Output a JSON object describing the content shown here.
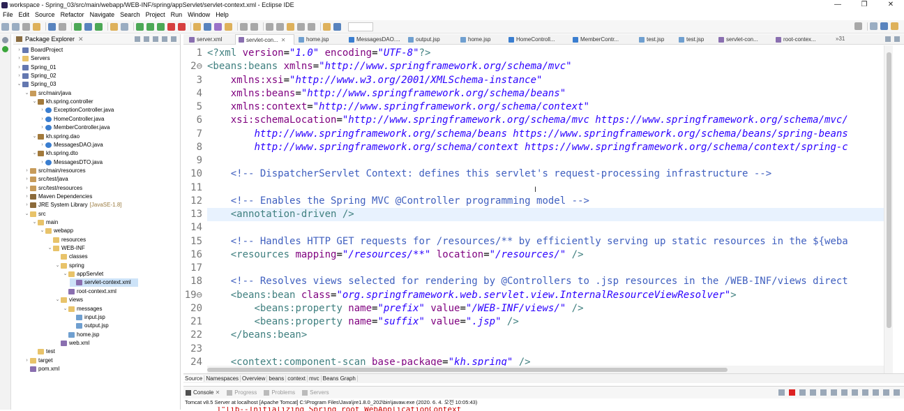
{
  "window": {
    "title": "workspace - Spring_03/src/main/webapp/WEB-INF/spring/appServlet/servlet-context.xml - Eclipse IDE",
    "controls": [
      "—",
      "❐",
      "✕"
    ]
  },
  "menu": [
    "File",
    "Edit",
    "Source",
    "Refactor",
    "Navigate",
    "Search",
    "Project",
    "Run",
    "Window",
    "Help"
  ],
  "package_explorer": {
    "title": "Package Explorer",
    "close": "✕",
    "tree": [
      {
        "label": "BoardProject",
        "icon": "proj",
        "twisty": "›",
        "depth": 0
      },
      {
        "label": "Servers",
        "icon": "fold",
        "twisty": "›",
        "depth": 0
      },
      {
        "label": "Spring_01",
        "icon": "proj",
        "twisty": "›",
        "depth": 0
      },
      {
        "label": "Spring_02",
        "icon": "proj",
        "twisty": "›",
        "depth": 0
      },
      {
        "label": "Spring_03",
        "icon": "proj",
        "twisty": "⌄",
        "depth": 0
      },
      {
        "label": "src/main/java",
        "icon": "pkgf",
        "twisty": "⌄",
        "depth": 1
      },
      {
        "label": "kh.spring.controller",
        "icon": "pkg",
        "twisty": "⌄",
        "depth": 2
      },
      {
        "label": "ExceptionController.java",
        "icon": "java",
        "twisty": "›",
        "depth": 3
      },
      {
        "label": "HomeController.java",
        "icon": "java",
        "twisty": "›",
        "depth": 3
      },
      {
        "label": "MemberController.java",
        "icon": "java",
        "twisty": "›",
        "depth": 3
      },
      {
        "label": "kh.spring.dao",
        "icon": "pkg",
        "twisty": "⌄",
        "depth": 2
      },
      {
        "label": "MessagesDAO.java",
        "icon": "java",
        "twisty": "›",
        "depth": 3
      },
      {
        "label": "kh.spring.dto",
        "icon": "pkg",
        "twisty": "⌄",
        "depth": 2
      },
      {
        "label": "MessagesDTO.java",
        "icon": "java",
        "twisty": "›",
        "depth": 3
      },
      {
        "label": "src/main/resources",
        "icon": "pkgf",
        "twisty": "›",
        "depth": 1
      },
      {
        "label": "src/test/java",
        "icon": "pkgf",
        "twisty": "›",
        "depth": 1
      },
      {
        "label": "src/test/resources",
        "icon": "pkgf",
        "twisty": "›",
        "depth": 1
      },
      {
        "label": "Maven Dependencies",
        "icon": "lib",
        "twisty": "›",
        "depth": 1
      },
      {
        "label": "JRE System Library",
        "icon": "lib",
        "twisty": "›",
        "depth": 1,
        "deco": "[JavaSE-1.8]"
      },
      {
        "label": "src",
        "icon": "fold",
        "twisty": "⌄",
        "depth": 1
      },
      {
        "label": "main",
        "icon": "fold",
        "twisty": "⌄",
        "depth": 2
      },
      {
        "label": "webapp",
        "icon": "fold",
        "twisty": "⌄",
        "depth": 3
      },
      {
        "label": "resources",
        "icon": "fold",
        "twisty": "",
        "depth": 4
      },
      {
        "label": "WEB-INF",
        "icon": "fold",
        "twisty": "⌄",
        "depth": 4
      },
      {
        "label": "classes",
        "icon": "fold",
        "twisty": "",
        "depth": 5
      },
      {
        "label": "spring",
        "icon": "fold",
        "twisty": "⌄",
        "depth": 5
      },
      {
        "label": "appServlet",
        "icon": "fold",
        "twisty": "⌄",
        "depth": 6
      },
      {
        "label": "servlet-context.xml",
        "icon": "xml",
        "twisty": "",
        "depth": 7,
        "selected": true
      },
      {
        "label": "root-context.xml",
        "icon": "xml",
        "twisty": "",
        "depth": 6
      },
      {
        "label": "views",
        "icon": "fold",
        "twisty": "⌄",
        "depth": 5
      },
      {
        "label": "messages",
        "icon": "fold",
        "twisty": "⌄",
        "depth": 6
      },
      {
        "label": "input.jsp",
        "icon": "jsp",
        "twisty": "",
        "depth": 7
      },
      {
        "label": "output.jsp",
        "icon": "jsp",
        "twisty": "",
        "depth": 7
      },
      {
        "label": "home.jsp",
        "icon": "jsp",
        "twisty": "",
        "depth": 6
      },
      {
        "label": "web.xml",
        "icon": "xml",
        "twisty": "",
        "depth": 5
      },
      {
        "label": "test",
        "icon": "fold",
        "twisty": "",
        "depth": 2
      },
      {
        "label": "target",
        "icon": "fold",
        "twisty": "›",
        "depth": 1
      },
      {
        "label": "pom.xml",
        "icon": "xml",
        "twisty": "",
        "depth": 1
      }
    ]
  },
  "editor": {
    "tabs": [
      {
        "label": "server.xml",
        "icon": "xml"
      },
      {
        "label": "servlet-con...",
        "icon": "xml",
        "active": true,
        "close": "✕"
      },
      {
        "label": "home.jsp",
        "icon": "jsp"
      },
      {
        "label": "MessagesDAO....",
        "icon": "java"
      },
      {
        "label": "output.jsp",
        "icon": "jsp"
      },
      {
        "label": "home.jsp",
        "icon": "jsp"
      },
      {
        "label": "HomeControll...",
        "icon": "java"
      },
      {
        "label": "MemberContr...",
        "icon": "java"
      },
      {
        "label": "test.jsp",
        "icon": "jsp"
      },
      {
        "label": "test.jsp",
        "icon": "jsp"
      },
      {
        "label": "servlet-con...",
        "icon": "xml"
      },
      {
        "label": "root-contex...",
        "icon": "xml"
      }
    ],
    "tabs_more": "»31",
    "lines": [
      {
        "n": "1",
        "t": [
          [
            "pi",
            "<?xml "
          ],
          [
            "at",
            "version"
          ],
          [
            "tx",
            "="
          ],
          [
            "st",
            "\"1.0\""
          ],
          [
            "tx",
            " "
          ],
          [
            "at",
            "encoding"
          ],
          [
            "tx",
            "="
          ],
          [
            "st",
            "\"UTF-8\""
          ],
          [
            "pi",
            "?>"
          ]
        ]
      },
      {
        "n": "2⊖",
        "t": [
          [
            "tag",
            "<beans:beans "
          ],
          [
            "at",
            "xmlns"
          ],
          [
            "tx",
            "="
          ],
          [
            "st",
            "\"http://www.springframework.org/schema/mvc\""
          ]
        ]
      },
      {
        "n": "3",
        "t": [
          [
            "tx",
            "    "
          ],
          [
            "at",
            "xmlns:xsi"
          ],
          [
            "tx",
            "="
          ],
          [
            "st",
            "\"http://www.w3.org/2001/XMLSchema-instance\""
          ]
        ]
      },
      {
        "n": "4",
        "t": [
          [
            "tx",
            "    "
          ],
          [
            "at",
            "xmlns:beans"
          ],
          [
            "tx",
            "="
          ],
          [
            "st",
            "\"http://www.springframework.org/schema/beans\""
          ]
        ]
      },
      {
        "n": "5",
        "t": [
          [
            "tx",
            "    "
          ],
          [
            "at",
            "xmlns:context"
          ],
          [
            "tx",
            "="
          ],
          [
            "st",
            "\"http://www.springframework.org/schema/context\""
          ]
        ]
      },
      {
        "n": "6",
        "t": [
          [
            "tx",
            "    "
          ],
          [
            "at",
            "xsi:schemaLocation"
          ],
          [
            "tx",
            "="
          ],
          [
            "st",
            "\"http://www.springframework.org/schema/mvc https://www.springframework.org/schema/mvc/"
          ]
        ]
      },
      {
        "n": "7",
        "t": [
          [
            "tx",
            "        "
          ],
          [
            "st",
            "http://www.springframework.org/schema/beans https://www.springframework.org/schema/beans/spring-beans"
          ]
        ]
      },
      {
        "n": "8",
        "t": [
          [
            "tx",
            "        "
          ],
          [
            "st",
            "http://www.springframework.org/schema/context https://www.springframework.org/schema/context/spring-c"
          ]
        ]
      },
      {
        "n": "9",
        "t": []
      },
      {
        "n": "10",
        "t": [
          [
            "tx",
            "    "
          ],
          [
            "cm",
            "<!-- DispatcherServlet Context: defines this servlet's request-processing infrastructure -->"
          ]
        ]
      },
      {
        "n": "11",
        "t": []
      },
      {
        "n": "12",
        "t": [
          [
            "tx",
            "    "
          ],
          [
            "cm",
            "<!-- Enables the Spring MVC @Controller programming model -->"
          ]
        ]
      },
      {
        "n": "13",
        "hl": true,
        "t": [
          [
            "tx",
            "    "
          ],
          [
            "tag",
            "<annotation-driven />"
          ]
        ]
      },
      {
        "n": "14",
        "t": []
      },
      {
        "n": "15",
        "t": [
          [
            "tx",
            "    "
          ],
          [
            "cm",
            "<!-- Handles HTTP GET requests for /resources/** by efficiently serving up static resources in the ${weba"
          ]
        ]
      },
      {
        "n": "16",
        "t": [
          [
            "tx",
            "    "
          ],
          [
            "tag",
            "<resources "
          ],
          [
            "at",
            "mapping"
          ],
          [
            "tx",
            "="
          ],
          [
            "st",
            "\"/resources/**\""
          ],
          [
            "tx",
            " "
          ],
          [
            "at",
            "location"
          ],
          [
            "tx",
            "="
          ],
          [
            "st",
            "\"/resources/\""
          ],
          [
            "tag",
            " />"
          ]
        ]
      },
      {
        "n": "17",
        "t": []
      },
      {
        "n": "18",
        "t": [
          [
            "tx",
            "    "
          ],
          [
            "cm",
            "<!-- Resolves views selected for rendering by @Controllers to .jsp resources in the /WEB-INF/views direct"
          ]
        ]
      },
      {
        "n": "19⊖",
        "t": [
          [
            "tx",
            "    "
          ],
          [
            "tag",
            "<beans:bean "
          ],
          [
            "at",
            "class"
          ],
          [
            "tx",
            "="
          ],
          [
            "st",
            "\"org.springframework.web.servlet.view.InternalResourceViewResolver\""
          ],
          [
            "tag",
            ">"
          ]
        ]
      },
      {
        "n": "20",
        "t": [
          [
            "tx",
            "        "
          ],
          [
            "tag",
            "<beans:property "
          ],
          [
            "at",
            "name"
          ],
          [
            "tx",
            "="
          ],
          [
            "st",
            "\"prefix\""
          ],
          [
            "tx",
            " "
          ],
          [
            "at",
            "value"
          ],
          [
            "tx",
            "="
          ],
          [
            "st",
            "\"/WEB-INF/views/\""
          ],
          [
            "tag",
            " />"
          ]
        ]
      },
      {
        "n": "21",
        "t": [
          [
            "tx",
            "        "
          ],
          [
            "tag",
            "<beans:property "
          ],
          [
            "at",
            "name"
          ],
          [
            "tx",
            "="
          ],
          [
            "st",
            "\"suffix\""
          ],
          [
            "tx",
            " "
          ],
          [
            "at",
            "value"
          ],
          [
            "tx",
            "="
          ],
          [
            "st",
            "\".jsp\""
          ],
          [
            "tag",
            " />"
          ]
        ]
      },
      {
        "n": "22",
        "t": [
          [
            "tx",
            "    "
          ],
          [
            "tag",
            "</beans:bean>"
          ]
        ]
      },
      {
        "n": "23",
        "t": []
      },
      {
        "n": "24",
        "t": [
          [
            "tx",
            "    "
          ],
          [
            "tag",
            "<context:component-scan "
          ],
          [
            "at",
            "base-package"
          ],
          [
            "tx",
            "="
          ],
          [
            "st",
            "\"kh.spring\""
          ],
          [
            "tag",
            " />"
          ]
        ]
      }
    ],
    "bottom_tabs": [
      "Source",
      "Namespaces",
      "Overview",
      "beans",
      "context",
      "mvc",
      "Beans Graph"
    ]
  },
  "console": {
    "tabs": [
      {
        "label": "Console",
        "close": "✕"
      },
      {
        "label": "Progress"
      },
      {
        "label": "Problems"
      },
      {
        "label": "Servers"
      }
    ],
    "text": "Tomcat v8.5 Server at localhost [Apache Tomcat] C:\\Program Files\\Java\\jre1.8.0_202\\bin\\javaw.exe (2020. 6. 4. 오전 10:05:43)",
    "peek": "  1\"lib--Initializing Spring root WebApplicationContext"
  },
  "colors": {
    "selection": "#cde3f8",
    "current_line": "#e8f2fe",
    "tag": "#3f7f7f",
    "attribute": "#7f007f",
    "string": "#2a00ff",
    "comment": "#3f5fbf"
  }
}
